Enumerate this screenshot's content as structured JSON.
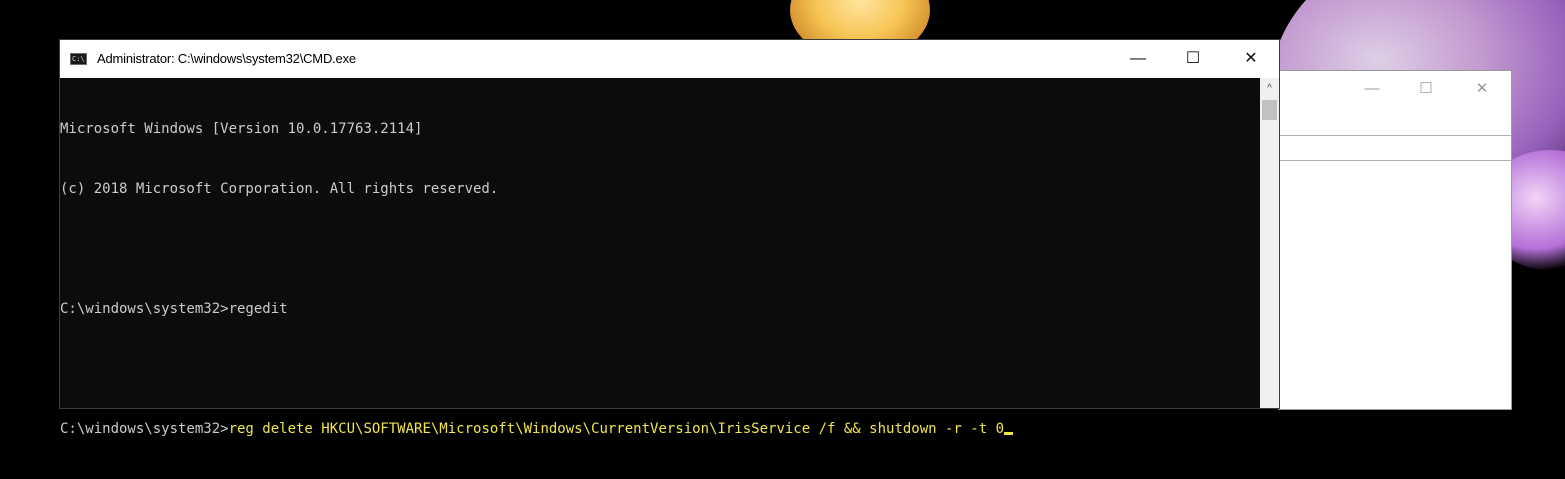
{
  "window": {
    "title": "Administrator: C:\\windows\\system32\\CMD.exe",
    "app_icon_text": "C:\\",
    "minimize_glyph": "—",
    "maximize_glyph": "☐",
    "close_glyph": "✕"
  },
  "console": {
    "lines": [
      {
        "plain": "Microsoft Windows [Version 10.0.17763.2114]"
      },
      {
        "plain": "(c) 2018 Microsoft Corporation. All rights reserved."
      },
      {
        "plain": ""
      },
      {
        "plain": "C:\\windows\\system32>regedit"
      },
      {
        "plain": ""
      },
      {
        "prompt": "C:\\windows\\system32>",
        "command": "reg delete HKCU\\SOFTWARE\\Microsoft\\Windows\\CurrentVersion\\IrisService /f && shutdown -r -t 0"
      }
    ],
    "text_color": "#cccccc",
    "command_color": "#f2e54a",
    "background": "#0c0c0c"
  },
  "scrollbar": {
    "up_glyph": "^"
  },
  "background_window": {
    "minimize_glyph": "—",
    "maximize_glyph": "☐",
    "close_glyph": "✕"
  }
}
